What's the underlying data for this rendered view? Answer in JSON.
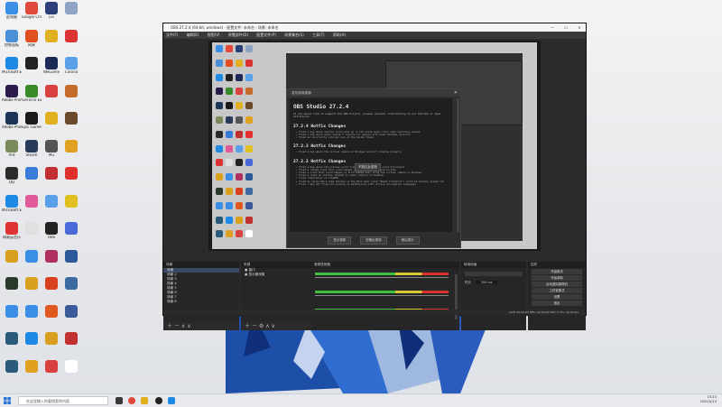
{
  "desktop": {
    "icons": [
      {
        "label": "此电脑",
        "color": "#3a8ee6"
      },
      {
        "label": "Google Chrome",
        "color": "#e04a3b"
      },
      {
        "label": "Lol",
        "color": "#2c3e7a"
      },
      {
        "label": "",
        "color": "#8fa4c4"
      },
      {
        "label": "控制面板",
        "color": "#4a90d9"
      },
      {
        "label": "网易",
        "color": "#e05020"
      },
      {
        "label": "",
        "color": "#e0b020"
      },
      {
        "label": "",
        "color": "#d33"
      },
      {
        "label": "Microsoft Edge",
        "color": "#1e88e5"
      },
      {
        "label": "",
        "color": "#222"
      },
      {
        "label": "WeGame",
        "color": "#1b2a55"
      },
      {
        "label": "Corona",
        "color": "#5aa0e8"
      },
      {
        "label": "Adobe Premiere",
        "color": "#2a1b4a"
      },
      {
        "label": "GeForce Experience",
        "color": "#3b8a2a"
      },
      {
        "label": "",
        "color": "#d94040"
      },
      {
        "label": "",
        "color": "#c46d2a"
      },
      {
        "label": "Adobe Photoshop",
        "color": "#1c3557"
      },
      {
        "label": "Epic Games",
        "color": "#1a1a1a"
      },
      {
        "label": "",
        "color": "#e0b020"
      },
      {
        "label": "",
        "color": "#6a4a2a"
      },
      {
        "label": "Ant",
        "color": "#7a8a5a"
      },
      {
        "label": "Steam",
        "color": "#2a3a5a"
      },
      {
        "label": "Mu",
        "color": "#555"
      },
      {
        "label": "",
        "color": "#e0a020"
      },
      {
        "label": "QQ",
        "color": "#2a2a2a"
      },
      {
        "label": "",
        "color": "#3a7ad9"
      },
      {
        "label": "",
        "color": "#c03030"
      },
      {
        "label": "",
        "color": "#e03030"
      },
      {
        "label": "Microsoft Edge",
        "color": "#1e88e5"
      },
      {
        "label": "",
        "color": "#e05a9a"
      },
      {
        "label": "",
        "color": "#5aa0e8"
      },
      {
        "label": "",
        "color": "#e0c020"
      },
      {
        "label": "网易云音乐",
        "color": "#d33"
      },
      {
        "label": "",
        "color": "#e0e0e0"
      },
      {
        "label": "OBS",
        "color": "#222"
      },
      {
        "label": "",
        "color": "#4a6ad9"
      },
      {
        "label": "",
        "color": "#d9a020"
      },
      {
        "label": "",
        "color": "#3a8ee6"
      },
      {
        "label": "",
        "color": "#b03060"
      },
      {
        "label": "",
        "color": "#2a5a9a"
      },
      {
        "label": "",
        "color": "#2a3a2a"
      },
      {
        "label": "",
        "color": "#d9a020"
      },
      {
        "label": "",
        "color": "#d94020"
      },
      {
        "label": "",
        "color": "#3a6aa0"
      },
      {
        "label": "",
        "color": "#3a8ee6"
      },
      {
        "label": "",
        "color": "#3a8ee6"
      },
      {
        "label": "",
        "color": "#e05a20"
      },
      {
        "label": "",
        "color": "#3a5a9a"
      },
      {
        "label": "",
        "color": "#2a5a7a"
      },
      {
        "label": "",
        "color": "#1e88e5"
      },
      {
        "label": "",
        "color": "#d9a020"
      },
      {
        "label": "",
        "color": "#c03030"
      },
      {
        "label": "",
        "color": "#2a5a7a"
      },
      {
        "label": "",
        "color": "#e0a020"
      },
      {
        "label": "",
        "color": "#d94040"
      },
      {
        "label": "",
        "color": "#fff"
      }
    ]
  },
  "obs": {
    "title": "OBS 27.2.4 (64-bit, windows) - 配置文件: 未命名 - 场景: 未命名",
    "menu": [
      "文件(F)",
      "编辑(E)",
      "视图(V)",
      "停靠部件(D)",
      "配置文件(P)",
      "场景集合(S)",
      "工具(T)",
      "帮助(H)"
    ],
    "scenes": {
      "header": "场景",
      "items": [
        "场景",
        "场景 2",
        "场景 3",
        "场景 4",
        "场景 5",
        "场景 6",
        "场景 7",
        "场景 8"
      ]
    },
    "sources": {
      "header": "来源",
      "items": [
        "窗口",
        "显示器采集"
      ]
    },
    "mixer": {
      "header": "音频混音器"
    },
    "transitions": {
      "header": "转场动画",
      "duration_label": "时长",
      "duration_value": "300 ms"
    },
    "controls": {
      "header": "控件",
      "buttons": [
        "开始推流",
        "开始录制",
        "启动虚拟摄像机",
        "工作室模式",
        "设置",
        "退出"
      ]
    },
    "status": "LIVE: 00:00:00   REC: 00:00:00   CPU: 0.3%, 30.00 fps",
    "dialog": {
      "title": "发布说明/更新",
      "heading": "OBS Studio 27.2.4",
      "intro": "If you would like to support the OBS Project, please consider contributing to our Patreon or Open Collective!",
      "sections": [
        {
          "title": "27.2.4 Hotfix Changes",
          "bullets": [
            "Fixed a bug where sources could show up in the wrong audio order when switching scenes",
            "Fixed a bug where audio wouldn't capture for people with older Windows versions",
            "Fixed an incorrectly colored icon on the Docker theme"
          ]
        },
        {
          "title": "27.2.3 Hotfix Changes",
          "bullets": [
            "Fixed a bug where the virtual camera on Windows wouldn't display properly"
          ]
        },
        {
          "title": "27.2.2 Hotfix Changes",
          "bullets": [
            "Fixed a bug where the preview could freeze, and the stream could disconnect",
            "Fixed a random crash that could happen on shutdown when using scripts",
            "Fixed a crash that could happen in ProfileName when using the virtual camera on Windows",
            "Fixed a crash on startup related to audio capture on Windows",
            "Fixed compilation on FreeBSD",
            "Fixed an issue where some options in the Edit menu (like \"Reset Transform\") could be wrongly grayed out",
            "Fixed .rtmp LOT files not working on macOS/Linux with certain non-english languages"
          ]
        }
      ],
      "buttons": [
        "显示更新",
        "忽略此更新",
        "稍后提示"
      ],
      "tooltip": "不跳过此更新"
    }
  },
  "taskbar": {
    "search_placeholder": "在这里输入你要搜索的内容",
    "time": "15:23",
    "date": "2022/4/14"
  },
  "colors": {
    "obs_bg": "#2b2b2b",
    "accent": "#3a8ee6",
    "meter_green": "#3fbf3f",
    "meter_yellow": "#d9c830",
    "meter_red": "#d93030"
  }
}
